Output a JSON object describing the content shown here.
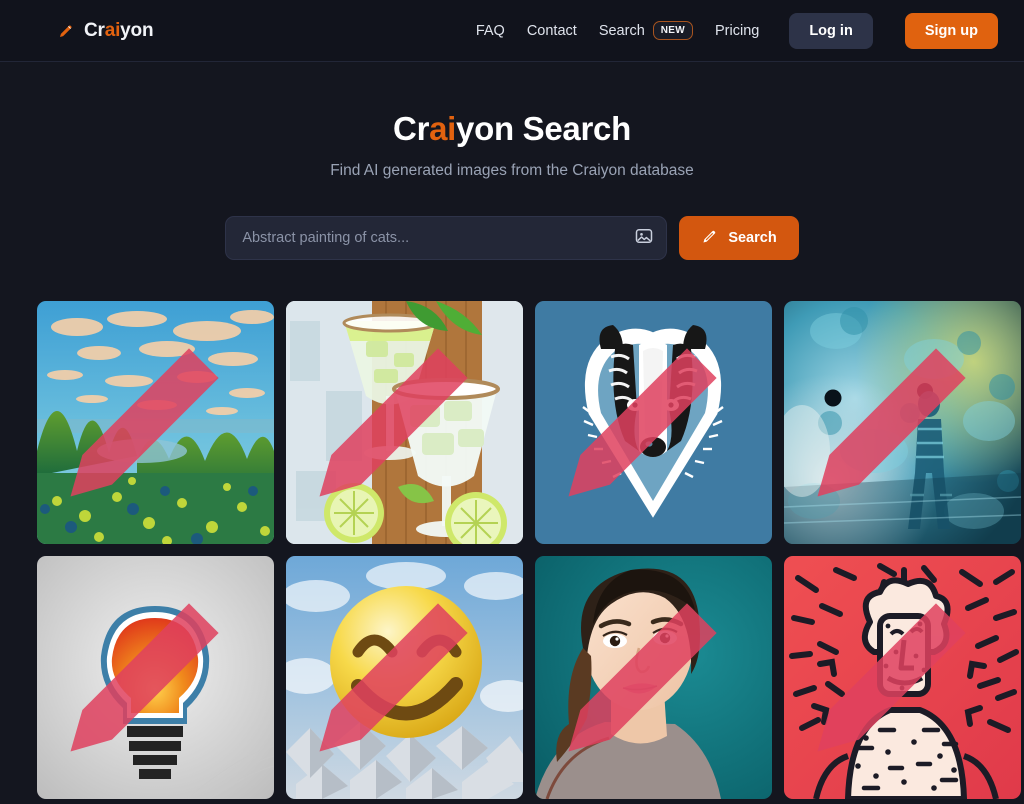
{
  "header": {
    "logo": {
      "prefix": "Cr",
      "accent": "ai",
      "suffix": "yon",
      "icon": "pencil-icon"
    },
    "nav": [
      {
        "label": "FAQ",
        "name": "faq"
      },
      {
        "label": "Contact",
        "name": "contact"
      },
      {
        "label": "Search",
        "name": "search",
        "badge": "NEW"
      },
      {
        "label": "Pricing",
        "name": "pricing"
      }
    ],
    "login_label": "Log in",
    "signup_label": "Sign up"
  },
  "hero": {
    "title_prefix": "Cr",
    "title_accent": "ai",
    "title_suffix": "yon Search",
    "subtitle": "Find AI generated images from the Craiyon database"
  },
  "search": {
    "placeholder": "Abstract painting of cats...",
    "value": "",
    "image_icon": "image-icon",
    "button_label": "Search",
    "button_icon": "pencil-icon"
  },
  "colors": {
    "accent": "#e0620f",
    "search_button": "#d3570f",
    "page_bg": "#14161f",
    "header_bg": "#11131c",
    "input_bg": "#232737",
    "login_bg": "#2d3348",
    "watermark": "#e0415f"
  },
  "gallery": {
    "watermark_icon": "pencil-watermark-icon",
    "items": [
      {
        "name": "impressionist-landscape-painting",
        "alt": "Impressionist oil painting of trees, pond and sky with clouds"
      },
      {
        "name": "margarita-cocktails-with-limes",
        "alt": "Painting of margarita cocktail glasses with lime slices on wood table"
      },
      {
        "name": "badger-head-illustration",
        "alt": "Black and white badger head illustration on blue background"
      },
      {
        "name": "abstract-blue-figure",
        "alt": "Abstract teal and blue smoky texture with a standing figure"
      },
      {
        "name": "lightbulb-icon-art",
        "alt": "Orange and red lightbulb icon on light gray gradient background"
      },
      {
        "name": "smiley-face-in-clouds",
        "alt": "Yellow smiley face emoji floating above clouds and crystals"
      },
      {
        "name": "portrait-of-woman",
        "alt": "Portrait photo of a smiling woman on teal background"
      },
      {
        "name": "keith-haring-style-figure",
        "alt": "Keith Haring style outlined figure on red background"
      }
    ]
  }
}
